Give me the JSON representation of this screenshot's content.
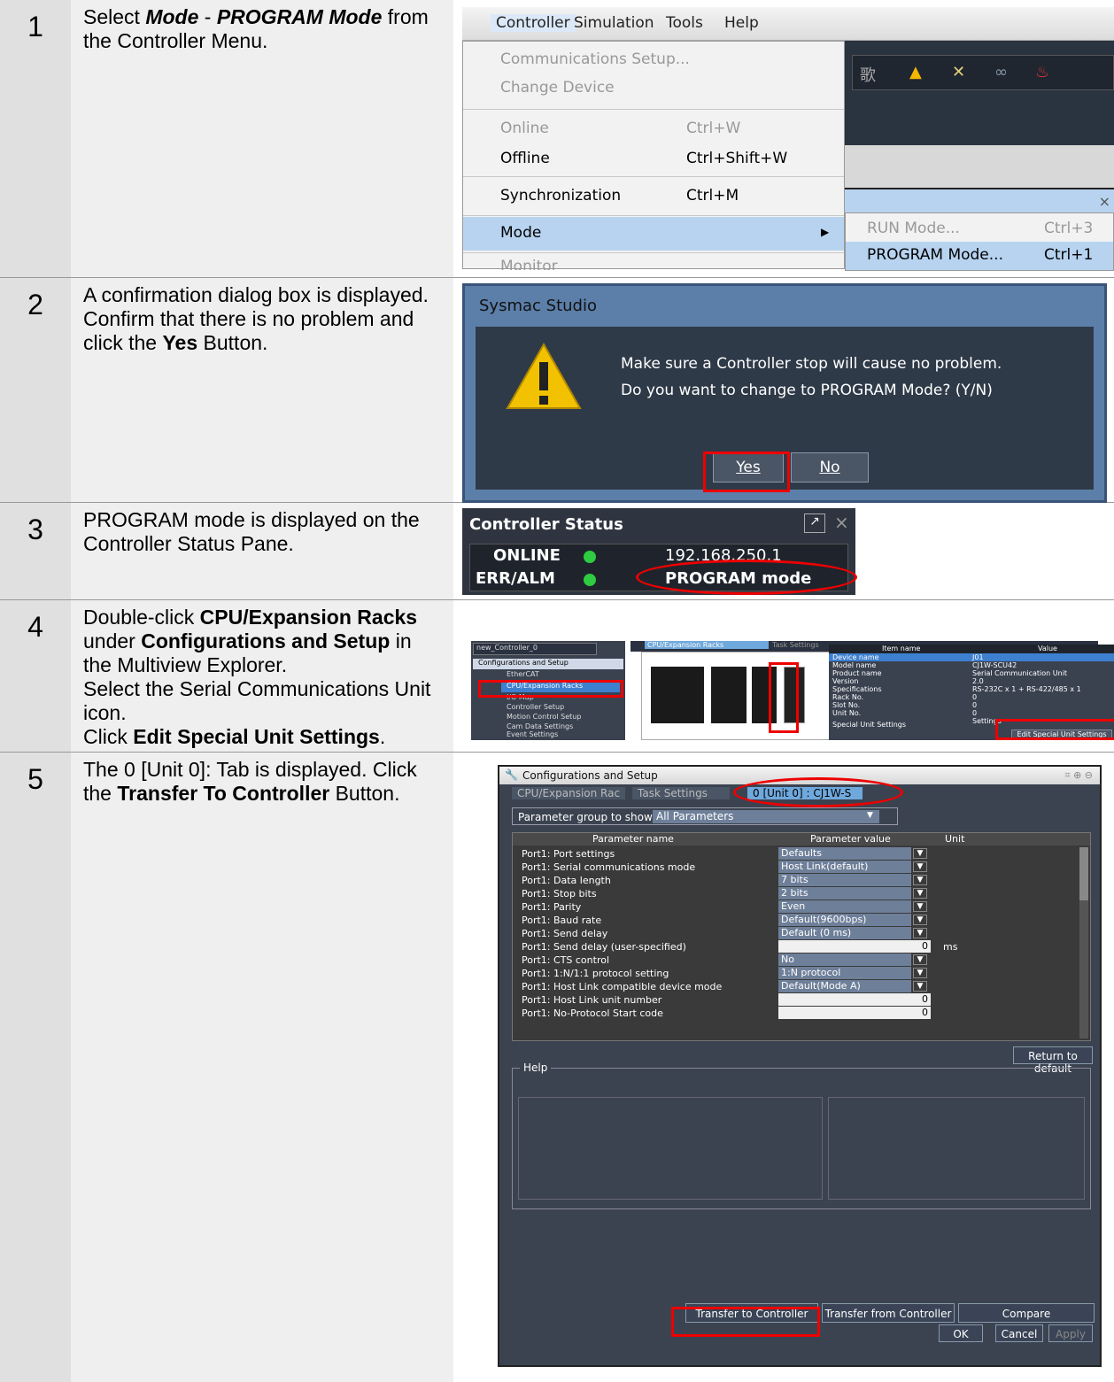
{
  "steps": [
    {
      "num": "1",
      "text_a": "Select ",
      "b1": "Mode",
      "text_b": " - ",
      "b2": "PROGRAM Mode",
      "text_c": " from the Controller Menu."
    },
    {
      "num": "2",
      "text_a": "A confirmation dialog box is displayed. Confirm that there is no problem and click the ",
      "b1": "Yes",
      "text_b": " Button."
    },
    {
      "num": "3",
      "text_a": "PROGRAM mode is displayed on the Controller Status Pane."
    },
    {
      "num": "4",
      "text_a": "Double-click ",
      "b1": "CPU/Expansion Racks",
      "text_b": " under ",
      "b2": "Configurations and Setup",
      "text_c": " in the Multiview Explorer.",
      "line2": "Select the Serial Communications Unit icon.",
      "line3_a": "Click ",
      "line3_b": "Edit Special Unit Settings",
      "line3_c": "."
    },
    {
      "num": "5",
      "text_a": "The 0 [Unit 0]: Tab is displayed. Click the ",
      "b1": "Transfer To Controller",
      "text_b": " Button."
    }
  ],
  "menu": {
    "bar": [
      "Controller",
      "Simulation",
      "Tools",
      "Help"
    ],
    "items": [
      {
        "label": "Communications Setup...",
        "shortcut": ""
      },
      {
        "label": "Change Device",
        "shortcut": ""
      },
      {
        "label": "Online",
        "shortcut": "Ctrl+W"
      },
      {
        "label": "Offline",
        "shortcut": "Ctrl+Shift+W"
      },
      {
        "label": "Synchronization",
        "shortcut": "Ctrl+M"
      },
      {
        "label": "Mode",
        "shortcut": ""
      },
      {
        "label": "Monitor",
        "shortcut": ""
      }
    ],
    "submenu": [
      {
        "label": "RUN Mode...",
        "shortcut": "Ctrl+3"
      },
      {
        "label": "PROGRAM Mode...",
        "shortcut": "Ctrl+1"
      }
    ]
  },
  "dialog": {
    "title": "Sysmac Studio",
    "line1": "Make sure a Controller stop will cause no problem.",
    "line2": "Do you want to change to PROGRAM Mode? (Y/N)",
    "yes": "Yes",
    "no": "No"
  },
  "status": {
    "title": "Controller Status",
    "online": "ONLINE",
    "ip": "192.168.250.1",
    "erralm": "ERR/ALM",
    "mode": "PROGRAM mode"
  },
  "explorer": {
    "controller": "new_Controller_0",
    "tree": [
      "Configurations and Setup",
      "EtherCAT",
      "CPU/Expansion Racks",
      "I/O Map",
      "Controller Setup",
      "Motion Control Setup",
      "Cam Data Settings",
      "Event Settings",
      "Task Settings"
    ],
    "tabs": [
      "CPU/Expansion Racks",
      "Task Settings"
    ],
    "grid_headers": [
      "Item name",
      "Value"
    ],
    "grid": [
      [
        "Device name",
        "J01"
      ],
      [
        "Model name",
        "CJ1W-SCU42"
      ],
      [
        "Product name",
        "Serial Communication Unit"
      ],
      [
        "Version",
        "2.0"
      ],
      [
        "Specifications",
        "RS-232C x 1 + RS-422/485 x 1"
      ],
      [
        "Rack No.",
        "0"
      ],
      [
        "Slot No.",
        "0"
      ],
      [
        "Unit No.",
        "0"
      ],
      [
        "Special Unit Settings",
        "Settings"
      ]
    ],
    "edit_button": "Edit Special Unit Settings"
  },
  "config": {
    "title": "Configurations and Setup",
    "tabs": [
      "CPU/Expansion Rac",
      "Task Settings",
      "0 [Unit 0] : CJ1W-S"
    ],
    "group_label": "Parameter group to show:",
    "group_value": "All Parameters",
    "headers": [
      "Parameter name",
      "Parameter value",
      "Unit"
    ],
    "rows": [
      {
        "name": "Port1: Port settings",
        "value": "Defaults",
        "unit": ""
      },
      {
        "name": "Port1: Serial communications mode",
        "value": "Host Link(default)",
        "unit": ""
      },
      {
        "name": "Port1: Data length",
        "value": "7 bits",
        "unit": ""
      },
      {
        "name": "Port1: Stop bits",
        "value": "2 bits",
        "unit": ""
      },
      {
        "name": "Port1: Parity",
        "value": "Even",
        "unit": ""
      },
      {
        "name": "Port1: Baud rate",
        "value": "Default(9600bps)",
        "unit": ""
      },
      {
        "name": "Port1: Send delay",
        "value": "Default (0 ms)",
        "unit": ""
      },
      {
        "name": "Port1: Send delay (user-specified)",
        "value": "0",
        "unit": "ms"
      },
      {
        "name": "Port1: CTS control",
        "value": "No",
        "unit": ""
      },
      {
        "name": "Port1: 1:N/1:1 protocol setting",
        "value": "1:N protocol",
        "unit": ""
      },
      {
        "name": "Port1: Host Link compatible device mode",
        "value": "Default(Mode A)",
        "unit": ""
      },
      {
        "name": "Port1: Host Link unit number",
        "value": "0",
        "unit": ""
      },
      {
        "name": "Port1: No-Protocol Start code",
        "value": "0",
        "unit": ""
      }
    ],
    "return_default": "Return to default",
    "help": "Help",
    "transfer_to": "Transfer to Controller",
    "transfer_from": "Transfer from Controller",
    "compare": "Compare",
    "ok": "OK",
    "cancel": "Cancel",
    "apply": "Apply"
  },
  "colors": {
    "highlight_red": "#e00000",
    "menu_select": "#b7d3f0",
    "status_green": "#2ecc40"
  }
}
